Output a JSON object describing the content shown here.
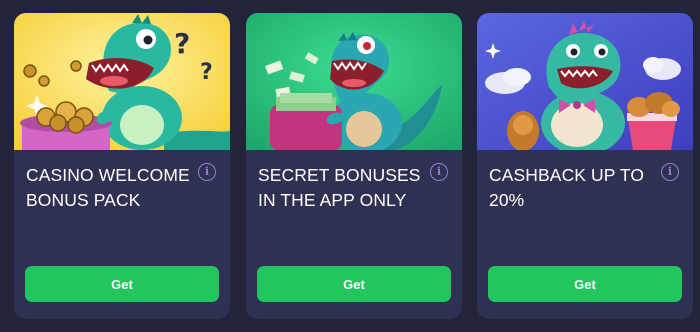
{
  "colors": {
    "page_background": "#222439",
    "card_background": "#2e3151",
    "button_green": "#22c55e",
    "info_icon": "#8e7fd6"
  },
  "offers": [
    {
      "title": "CASINO WELCOME BONUS PACK",
      "button_label": "Get",
      "info_icon": "info-icon",
      "art": "dinosaur-with-gold-coins-and-question-marks"
    },
    {
      "title": "SECRET BONUSES IN THE APP ONLY",
      "button_label": "Get",
      "info_icon": "info-icon",
      "art": "dinosaur-with-money-wallet"
    },
    {
      "title": "CASHBACK UP TO 20%",
      "button_label": "Get",
      "info_icon": "info-icon",
      "art": "dinosaur-with-fried-chicken-bucket"
    }
  ]
}
